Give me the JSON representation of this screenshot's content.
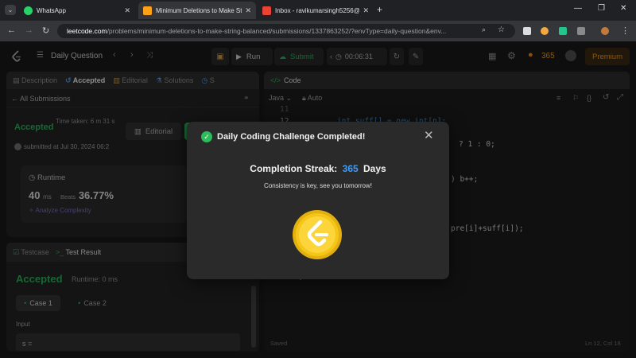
{
  "browser": {
    "tabs": [
      {
        "title": "WhatsApp"
      },
      {
        "title": "Minimum Deletions to Make St"
      },
      {
        "title": "Inbox - ravikumarsingh5256@g"
      }
    ],
    "new_tab": "+",
    "url_host": "leetcode.com",
    "url_path": "/problems/minimum-deletions-to-make-string-balanced/submissions/1337863252/?envType=daily-question&env..."
  },
  "topbar": {
    "daily_question": "Daily Question",
    "run": "Run",
    "submit": "Submit",
    "timer": "00:06:31",
    "streak_count": "365",
    "premium": "Premium"
  },
  "left_panel": {
    "tabs": {
      "description": "Description",
      "accepted": "Accepted",
      "editorial": "Editorial",
      "solutions": "Solutions",
      "more": "S"
    },
    "all_submissions": "All Submissions",
    "status": "Accepted",
    "time_taken": "Time taken: 6 m 31 s",
    "editorial_btn": "Editorial",
    "submitted_at": "submitted at Jul 30, 2024 06:2",
    "runtime_label": "Runtime",
    "runtime_value": "40",
    "runtime_unit": "ms",
    "beats_label": "Beats",
    "beats_value": "36.77%",
    "analyze": "Analyze Complexity"
  },
  "bottom_panel": {
    "testcase_tab": "Testcase",
    "result_tab": "Test Result",
    "status": "Accepted",
    "runtime": "Runtime: 0 ms",
    "case1": "Case 1",
    "case2": "Case 2",
    "input_label": "Input",
    "input_value": "s ="
  },
  "code_panel": {
    "title": "Code",
    "language": "Java",
    "auto": "Auto",
    "lines": [
      {
        "num": "11",
        "text": ""
      },
      {
        "num": "12",
        "text": "int suff[] = new int[n];"
      },
      {
        "num": "",
        "text": "? 1 : 0;"
      },
      {
        "num": "",
        "text": ") b++;"
      },
      {
        "num": "",
        "text": "pre[i]+suff[i]);"
      },
      {
        "num": "",
        "text": "}"
      }
    ],
    "saved": "Saved",
    "position": "Ln 12, Col 18"
  },
  "modal": {
    "title": "Daily Coding Challenge Completed!",
    "streak_label": "Completion Streak:",
    "streak_value": "365",
    "streak_unit": "Days",
    "message": "Consistency is key, see you tomorrow!",
    "colors": {
      "accent": "#2cbb5d",
      "streak": "#3b9dff",
      "coin": "#f5c518"
    }
  }
}
